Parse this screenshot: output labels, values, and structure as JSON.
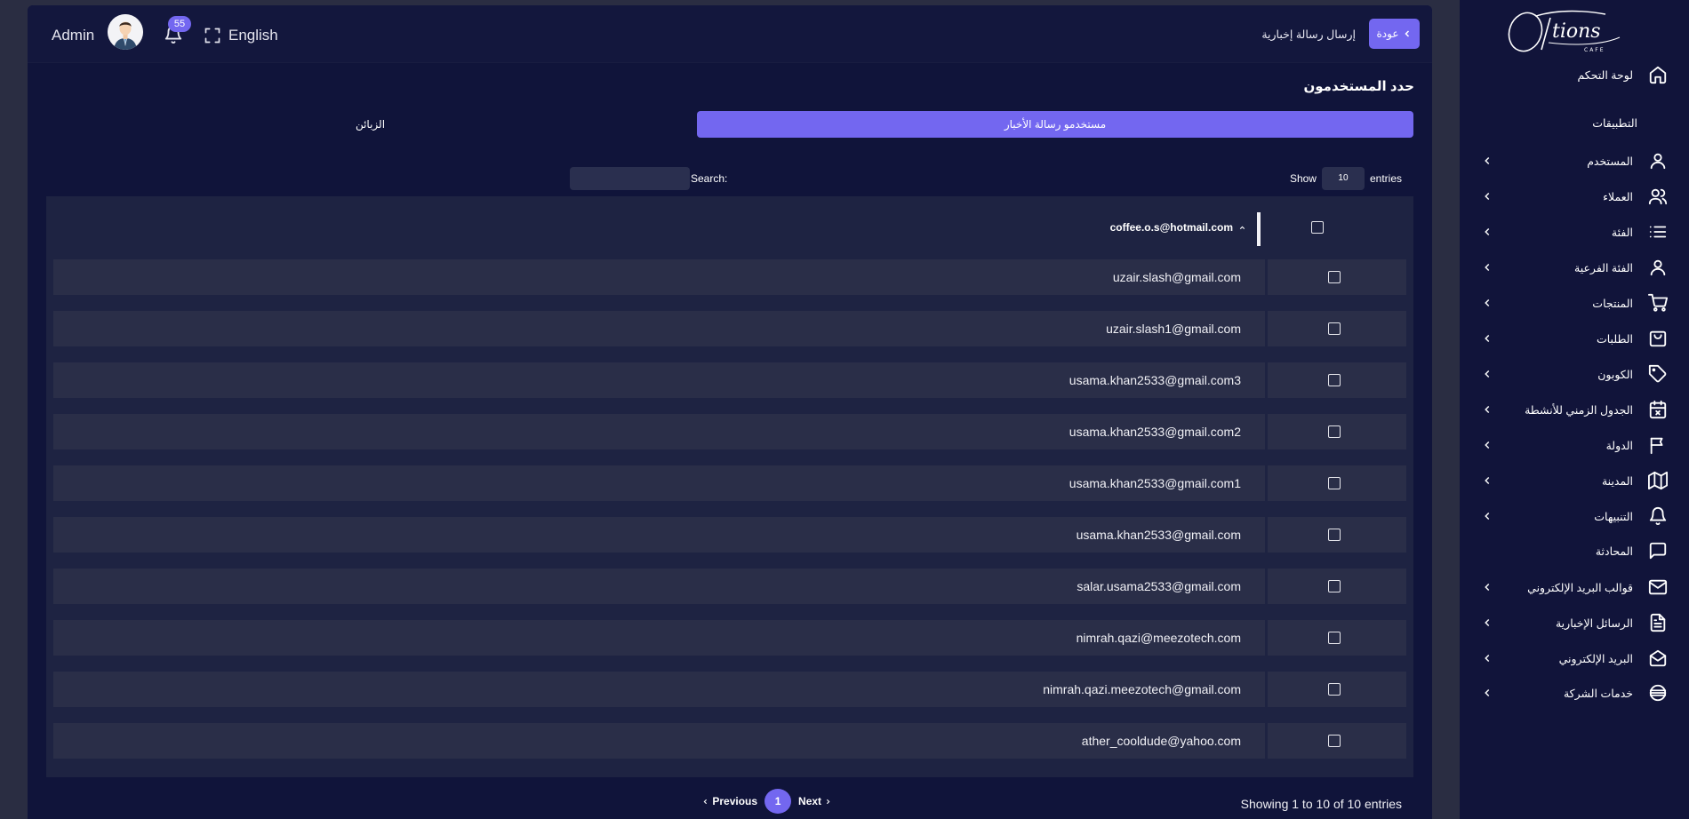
{
  "brand": {
    "logo_text": "Options",
    "logo_sub": "CAFE"
  },
  "colors": {
    "accent": "#7367f0",
    "sidebar_bg": "#11143a",
    "main_bg": "#10143a",
    "table_bg": "#1e2342",
    "row_bg": "#2a2e48"
  },
  "sidebar": {
    "dashboard": {
      "label": "لوحة التحكم",
      "icon": "home-icon"
    },
    "section_label": "التطبيقات",
    "items": [
      {
        "label": "المستخدم",
        "icon": "user-icon",
        "has_children": true
      },
      {
        "label": "العملاء",
        "icon": "users-icon",
        "has_children": true
      },
      {
        "label": "الفئة",
        "icon": "list-icon",
        "has_children": true
      },
      {
        "label": "الفئة الفرعية",
        "icon": "user-icon",
        "has_children": true
      },
      {
        "label": "المنتجات",
        "icon": "cart-icon",
        "has_children": true
      },
      {
        "label": "الطلبات",
        "icon": "bag-icon",
        "has_children": true
      },
      {
        "label": "الكوبون",
        "icon": "tag-icon",
        "has_children": true
      },
      {
        "label": "الجدول الزمني للأنشطة",
        "icon": "calendar-x-icon",
        "has_children": true
      },
      {
        "label": "الدولة",
        "icon": "flag-icon",
        "has_children": true
      },
      {
        "label": "المدينة",
        "icon": "map-icon",
        "has_children": true
      },
      {
        "label": "التنبيهات",
        "icon": "bell-icon",
        "has_children": true
      },
      {
        "label": "المحادثة",
        "icon": "chat-icon",
        "has_children": false
      },
      {
        "label": "قوالب البريد الإلكتروني",
        "icon": "mail-icon",
        "has_children": true
      },
      {
        "label": "الرسائل الإخبارية",
        "icon": "file-text-icon",
        "has_children": true
      },
      {
        "label": "البريد الإلكتروني",
        "icon": "mail-open-icon",
        "has_children": true
      },
      {
        "label": "خدمات الشركة",
        "icon": "globe-icon",
        "has_children": true
      }
    ]
  },
  "topbar": {
    "back_label": "عودة",
    "page_title": "إرسال رسالة إخبارية",
    "admin_name": "Admin",
    "notification_count": "55",
    "language": "English"
  },
  "main": {
    "section_title": "حدد المستخدمون",
    "tabs": [
      {
        "label": "مستخدمو رسالة الأخبار",
        "active": true
      },
      {
        "label": "الزبائن",
        "active": false
      }
    ],
    "entries": {
      "show_label": "Show",
      "value": "10",
      "suffix": "entries"
    },
    "search": {
      "label": "Search:",
      "value": ""
    },
    "table": {
      "header_email": "coffee.o.s@hotmail.com",
      "rows": [
        "uzair.slash@gmail.com",
        "uzair.slash1@gmail.com",
        "usama.khan2533@gmail.com3",
        "usama.khan2533@gmail.com2",
        "usama.khan2533@gmail.com1",
        "usama.khan2533@gmail.com",
        "salar.usama2533@gmail.com",
        "nimrah.qazi@meezotech.com",
        "nimrah.qazi.meezotech@gmail.com",
        "ather_cooldude@yahoo.com"
      ]
    },
    "footer": {
      "showing_text": "Showing 1 to 10 of 10 entries",
      "previous": "Previous",
      "next": "Next",
      "current_page": "1"
    }
  }
}
